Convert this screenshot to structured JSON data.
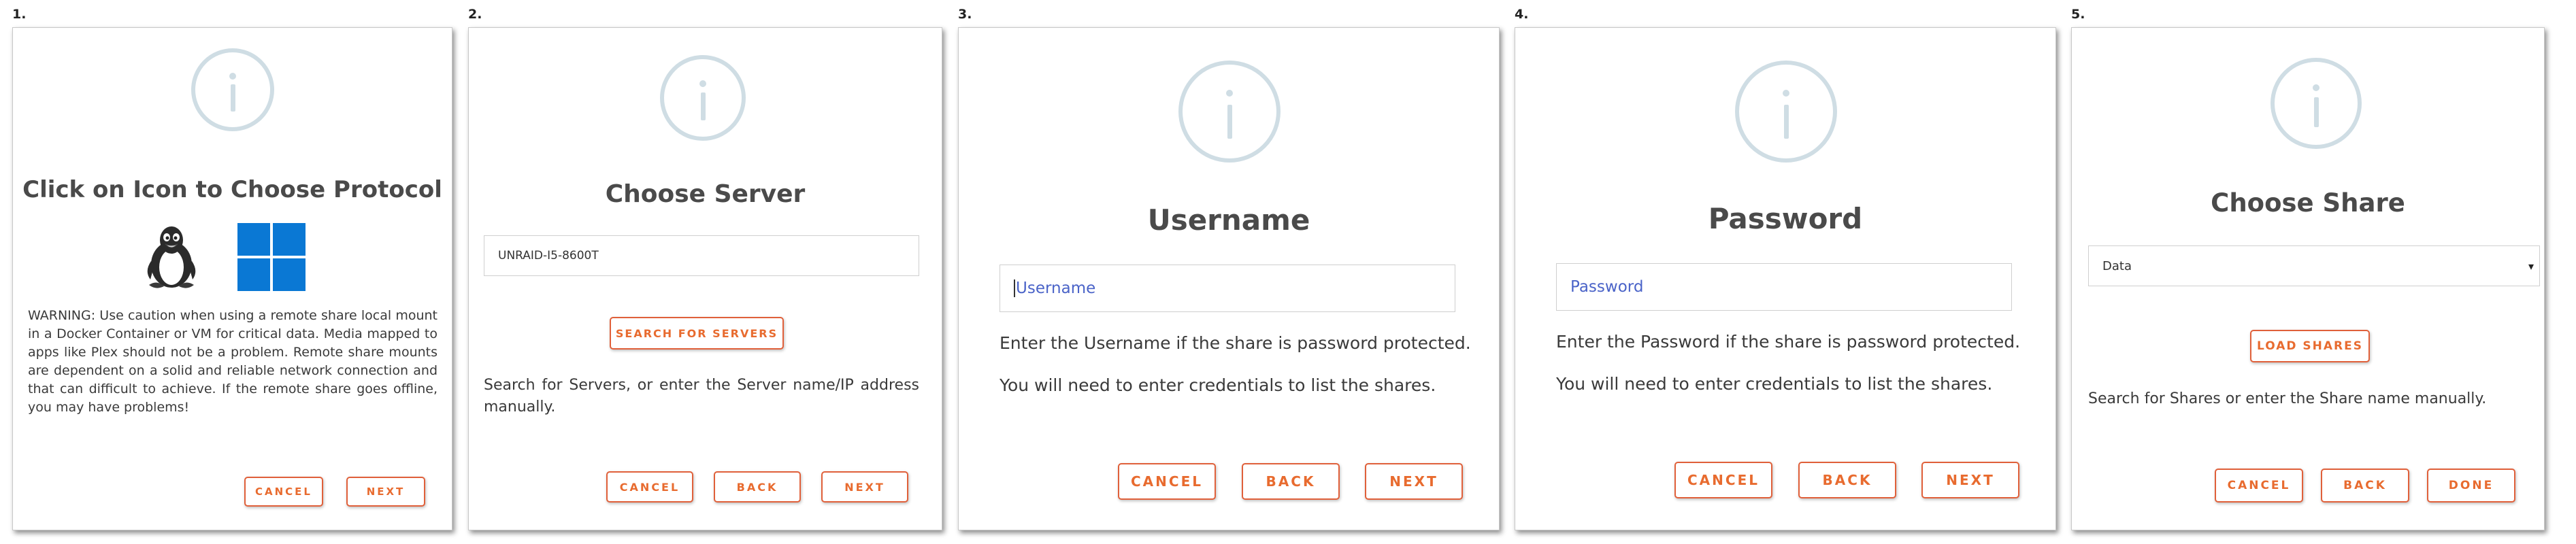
{
  "steps": [
    {
      "number": "1.",
      "title": "Click on Icon to Choose Protocol",
      "protocol_icons": [
        "linux-tux-icon",
        "windows-icon"
      ],
      "warning": "WARNING: Use caution when using a remote share local mount in a Docker Container or VM for critical data. Media mapped to apps like Plex should not be a problem. Remote share mounts are dependent on a solid and reliable network connection and that can difficult to achieve. If the remote share goes offline, you may have problems!",
      "buttons": {
        "cancel": "CANCEL",
        "next": "NEXT"
      }
    },
    {
      "number": "2.",
      "title": "Choose Server",
      "server_input_value": "UNRAID-I5-8600T",
      "search_button": "SEARCH FOR SERVERS",
      "help": "Search for Servers, or enter the Server name/IP address manually.",
      "buttons": {
        "cancel": "CANCEL",
        "back": "BACK",
        "next": "NEXT"
      }
    },
    {
      "number": "3.",
      "title": "Username",
      "username_placeholder": "Username",
      "help1": "Enter the Username if the share is password protected.",
      "help2": "You will need to enter credentials to list the shares.",
      "buttons": {
        "cancel": "CANCEL",
        "back": "BACK",
        "next": "NEXT"
      }
    },
    {
      "number": "4.",
      "title": "Password",
      "password_placeholder": "Password",
      "help1": "Enter the Password if the share is password protected.",
      "help2": "You will need to enter credentials to list the shares.",
      "buttons": {
        "cancel": "CANCEL",
        "back": "BACK",
        "next": "NEXT"
      }
    },
    {
      "number": "5.",
      "title": "Choose Share",
      "share_select_value": "Data",
      "load_button": "LOAD SHARES",
      "help": "Search for Shares or enter the Share name manually.",
      "buttons": {
        "cancel": "CANCEL",
        "back": "BACK",
        "done": "DONE"
      }
    }
  ],
  "colors": {
    "button_text": "#e86b2f",
    "button_border": "#e0603a",
    "info_icon": "#cfdde4",
    "placeholder": "#4a63c8",
    "windows_blue": "#0a78d4"
  }
}
